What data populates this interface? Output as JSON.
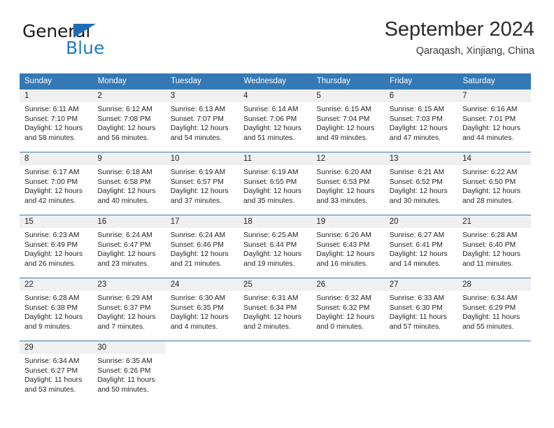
{
  "brand": {
    "name_top": "General",
    "name_bottom": "Blue",
    "triangle_color": "#1f6eb5",
    "blue_text_color": "#1f7ec4"
  },
  "header": {
    "title": "September 2024",
    "subtitle": "Qaraqash, Xinjiang, China"
  },
  "theme": {
    "header_blue": "#3479b5",
    "daynum_band": "#f0f0f0",
    "text": "#252525"
  },
  "weekday_headers": [
    "Sunday",
    "Monday",
    "Tuesday",
    "Wednesday",
    "Thursday",
    "Friday",
    "Saturday"
  ],
  "weeks": [
    [
      {
        "day": "1",
        "sunrise": "Sunrise: 6:11 AM",
        "sunset": "Sunset: 7:10 PM",
        "daylight1": "Daylight: 12 hours",
        "daylight2": "and 58 minutes."
      },
      {
        "day": "2",
        "sunrise": "Sunrise: 6:12 AM",
        "sunset": "Sunset: 7:08 PM",
        "daylight1": "Daylight: 12 hours",
        "daylight2": "and 56 minutes."
      },
      {
        "day": "3",
        "sunrise": "Sunrise: 6:13 AM",
        "sunset": "Sunset: 7:07 PM",
        "daylight1": "Daylight: 12 hours",
        "daylight2": "and 54 minutes."
      },
      {
        "day": "4",
        "sunrise": "Sunrise: 6:14 AM",
        "sunset": "Sunset: 7:06 PM",
        "daylight1": "Daylight: 12 hours",
        "daylight2": "and 51 minutes."
      },
      {
        "day": "5",
        "sunrise": "Sunrise: 6:15 AM",
        "sunset": "Sunset: 7:04 PM",
        "daylight1": "Daylight: 12 hours",
        "daylight2": "and 49 minutes."
      },
      {
        "day": "6",
        "sunrise": "Sunrise: 6:15 AM",
        "sunset": "Sunset: 7:03 PM",
        "daylight1": "Daylight: 12 hours",
        "daylight2": "and 47 minutes."
      },
      {
        "day": "7",
        "sunrise": "Sunrise: 6:16 AM",
        "sunset": "Sunset: 7:01 PM",
        "daylight1": "Daylight: 12 hours",
        "daylight2": "and 44 minutes."
      }
    ],
    [
      {
        "day": "8",
        "sunrise": "Sunrise: 6:17 AM",
        "sunset": "Sunset: 7:00 PM",
        "daylight1": "Daylight: 12 hours",
        "daylight2": "and 42 minutes."
      },
      {
        "day": "9",
        "sunrise": "Sunrise: 6:18 AM",
        "sunset": "Sunset: 6:58 PM",
        "daylight1": "Daylight: 12 hours",
        "daylight2": "and 40 minutes."
      },
      {
        "day": "10",
        "sunrise": "Sunrise: 6:19 AM",
        "sunset": "Sunset: 6:57 PM",
        "daylight1": "Daylight: 12 hours",
        "daylight2": "and 37 minutes."
      },
      {
        "day": "11",
        "sunrise": "Sunrise: 6:19 AM",
        "sunset": "Sunset: 6:55 PM",
        "daylight1": "Daylight: 12 hours",
        "daylight2": "and 35 minutes."
      },
      {
        "day": "12",
        "sunrise": "Sunrise: 6:20 AM",
        "sunset": "Sunset: 6:53 PM",
        "daylight1": "Daylight: 12 hours",
        "daylight2": "and 33 minutes."
      },
      {
        "day": "13",
        "sunrise": "Sunrise: 6:21 AM",
        "sunset": "Sunset: 6:52 PM",
        "daylight1": "Daylight: 12 hours",
        "daylight2": "and 30 minutes."
      },
      {
        "day": "14",
        "sunrise": "Sunrise: 6:22 AM",
        "sunset": "Sunset: 6:50 PM",
        "daylight1": "Daylight: 12 hours",
        "daylight2": "and 28 minutes."
      }
    ],
    [
      {
        "day": "15",
        "sunrise": "Sunrise: 6:23 AM",
        "sunset": "Sunset: 6:49 PM",
        "daylight1": "Daylight: 12 hours",
        "daylight2": "and 26 minutes."
      },
      {
        "day": "16",
        "sunrise": "Sunrise: 6:24 AM",
        "sunset": "Sunset: 6:47 PM",
        "daylight1": "Daylight: 12 hours",
        "daylight2": "and 23 minutes."
      },
      {
        "day": "17",
        "sunrise": "Sunrise: 6:24 AM",
        "sunset": "Sunset: 6:46 PM",
        "daylight1": "Daylight: 12 hours",
        "daylight2": "and 21 minutes."
      },
      {
        "day": "18",
        "sunrise": "Sunrise: 6:25 AM",
        "sunset": "Sunset: 6:44 PM",
        "daylight1": "Daylight: 12 hours",
        "daylight2": "and 19 minutes."
      },
      {
        "day": "19",
        "sunrise": "Sunrise: 6:26 AM",
        "sunset": "Sunset: 6:43 PM",
        "daylight1": "Daylight: 12 hours",
        "daylight2": "and 16 minutes."
      },
      {
        "day": "20",
        "sunrise": "Sunrise: 6:27 AM",
        "sunset": "Sunset: 6:41 PM",
        "daylight1": "Daylight: 12 hours",
        "daylight2": "and 14 minutes."
      },
      {
        "day": "21",
        "sunrise": "Sunrise: 6:28 AM",
        "sunset": "Sunset: 6:40 PM",
        "daylight1": "Daylight: 12 hours",
        "daylight2": "and 11 minutes."
      }
    ],
    [
      {
        "day": "22",
        "sunrise": "Sunrise: 6:28 AM",
        "sunset": "Sunset: 6:38 PM",
        "daylight1": "Daylight: 12 hours",
        "daylight2": "and 9 minutes."
      },
      {
        "day": "23",
        "sunrise": "Sunrise: 6:29 AM",
        "sunset": "Sunset: 6:37 PM",
        "daylight1": "Daylight: 12 hours",
        "daylight2": "and 7 minutes."
      },
      {
        "day": "24",
        "sunrise": "Sunrise: 6:30 AM",
        "sunset": "Sunset: 6:35 PM",
        "daylight1": "Daylight: 12 hours",
        "daylight2": "and 4 minutes."
      },
      {
        "day": "25",
        "sunrise": "Sunrise: 6:31 AM",
        "sunset": "Sunset: 6:34 PM",
        "daylight1": "Daylight: 12 hours",
        "daylight2": "and 2 minutes."
      },
      {
        "day": "26",
        "sunrise": "Sunrise: 6:32 AM",
        "sunset": "Sunset: 6:32 PM",
        "daylight1": "Daylight: 12 hours",
        "daylight2": "and 0 minutes."
      },
      {
        "day": "27",
        "sunrise": "Sunrise: 6:33 AM",
        "sunset": "Sunset: 6:30 PM",
        "daylight1": "Daylight: 11 hours",
        "daylight2": "and 57 minutes."
      },
      {
        "day": "28",
        "sunrise": "Sunrise: 6:34 AM",
        "sunset": "Sunset: 6:29 PM",
        "daylight1": "Daylight: 11 hours",
        "daylight2": "and 55 minutes."
      }
    ],
    [
      {
        "day": "29",
        "sunrise": "Sunrise: 6:34 AM",
        "sunset": "Sunset: 6:27 PM",
        "daylight1": "Daylight: 11 hours",
        "daylight2": "and 53 minutes."
      },
      {
        "day": "30",
        "sunrise": "Sunrise: 6:35 AM",
        "sunset": "Sunset: 6:26 PM",
        "daylight1": "Daylight: 11 hours",
        "daylight2": "and 50 minutes."
      },
      {
        "day": "",
        "sunrise": "",
        "sunset": "",
        "daylight1": "",
        "daylight2": ""
      },
      {
        "day": "",
        "sunrise": "",
        "sunset": "",
        "daylight1": "",
        "daylight2": ""
      },
      {
        "day": "",
        "sunrise": "",
        "sunset": "",
        "daylight1": "",
        "daylight2": ""
      },
      {
        "day": "",
        "sunrise": "",
        "sunset": "",
        "daylight1": "",
        "daylight2": ""
      },
      {
        "day": "",
        "sunrise": "",
        "sunset": "",
        "daylight1": "",
        "daylight2": ""
      }
    ]
  ]
}
